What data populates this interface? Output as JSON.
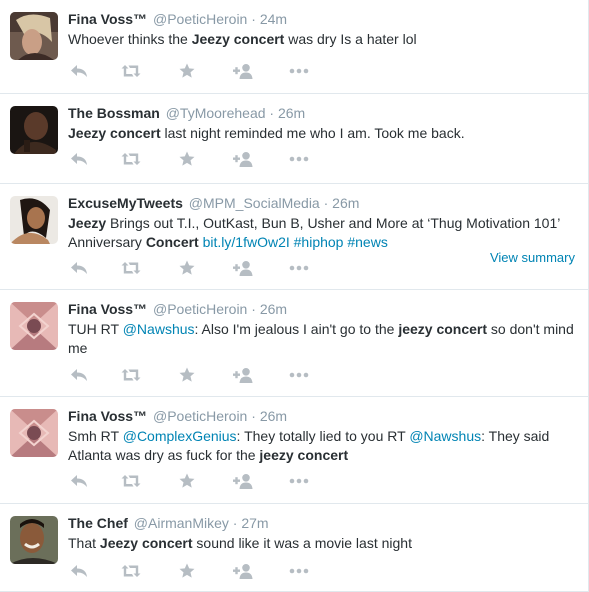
{
  "tweets": [
    {
      "name": "Fina Voss™",
      "handle": "@PoeticHeroin",
      "sep": "·",
      "time": "24m",
      "segments": [
        {
          "t": "Whoever thinks the "
        },
        {
          "t": "Jeezy concert",
          "b": true
        },
        {
          "t": " was dry Is a hater lol"
        }
      ]
    },
    {
      "name": "The Bossman",
      "handle": "@TyMoorehead",
      "sep": "·",
      "time": "26m",
      "segments": [
        {
          "t": "Jeezy concert",
          "b": true
        },
        {
          "t": " last night reminded me who I am. Took me back."
        }
      ]
    },
    {
      "name": "ExcuseMyTweets",
      "handle": "@MPM_SocialMedia",
      "sep": "·",
      "time": "26m",
      "segments": [
        {
          "t": "Jeezy",
          "b": true
        },
        {
          "t": " Brings out T.I., OutKast, Bun B, Usher and More at ‘Thug Motivation 101’ Anniversary "
        },
        {
          "t": "Concert",
          "b": true
        },
        {
          "t": " "
        },
        {
          "t": "bit.ly/1fwOw2I",
          "l": true
        },
        {
          "t": " "
        },
        {
          "t": "#hiphop",
          "l": true
        },
        {
          "t": " "
        },
        {
          "t": "#news",
          "l": true
        }
      ],
      "summary": "View summary"
    },
    {
      "name": "Fina Voss™",
      "handle": "@PoeticHeroin",
      "sep": "·",
      "time": "26m",
      "segments": [
        {
          "t": "TUH RT "
        },
        {
          "t": "@Nawshus",
          "l": true
        },
        {
          "t": ": Also I'm jealous I ain't go to the "
        },
        {
          "t": "jeezy concert",
          "b": true
        },
        {
          "t": " so don't mind me"
        }
      ]
    },
    {
      "name": "Fina Voss™",
      "handle": "@PoeticHeroin",
      "sep": "·",
      "time": "26m",
      "segments": [
        {
          "t": "Smh RT "
        },
        {
          "t": "@ComplexGenius",
          "l": true
        },
        {
          "t": ": They totally lied to you RT "
        },
        {
          "t": "@Nawshus",
          "l": true
        },
        {
          "t": ": They said Atlanta was dry as fuck for the "
        },
        {
          "t": "jeezy concert",
          "b": true
        }
      ]
    },
    {
      "name": "The Chef",
      "handle": "@AirmanMikey",
      "sep": "·",
      "time": "27m",
      "segments": [
        {
          "t": "That "
        },
        {
          "t": "Jeezy concert",
          "b": true
        },
        {
          "t": " sound like it was a movie last night"
        }
      ]
    }
  ],
  "action_icons": [
    "reply-icon",
    "retweet-icon",
    "favorite-icon",
    "follow-icon",
    "more-icon"
  ],
  "colors": {
    "text": "#292f33",
    "meta": "#8899a6",
    "link": "#0084b4",
    "icon": "#b6bdc3",
    "border": "#e1e8ed"
  }
}
